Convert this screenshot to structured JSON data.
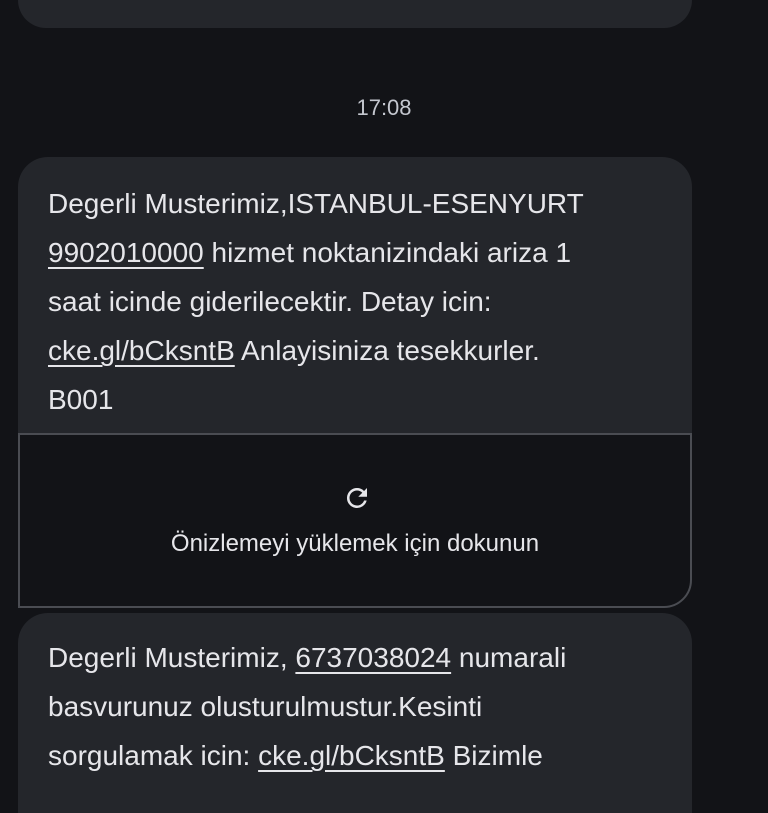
{
  "timestamp": "17:08",
  "message1": {
    "line1": "Degerli Musterimiz,ISTANBUL-ESENYURT",
    "line2_link": "9902010000",
    "line2_rest": " hizmet noktanizindaki ariza 1",
    "line3": "saat icinde giderilecektir. Detay icin:",
    "line4_link": "cke.gl/bCksntB",
    "line4_rest": " Anlayisiniza tesekkurler.",
    "line5": "B001"
  },
  "preview": {
    "icon": "refresh-icon",
    "label": "Önizlemeyi yüklemek için dokunun"
  },
  "message2": {
    "line1_prefix": "Degerli Musterimiz, ",
    "line1_link": "6737038024",
    "line1_rest": " numarali",
    "line2": "basvurunuz olusturulmustur.Kesinti",
    "line3_prefix": "sorgulamak icin: ",
    "line3_link": "cke.gl/bCksntB",
    "line3_rest": " Bizimle"
  }
}
